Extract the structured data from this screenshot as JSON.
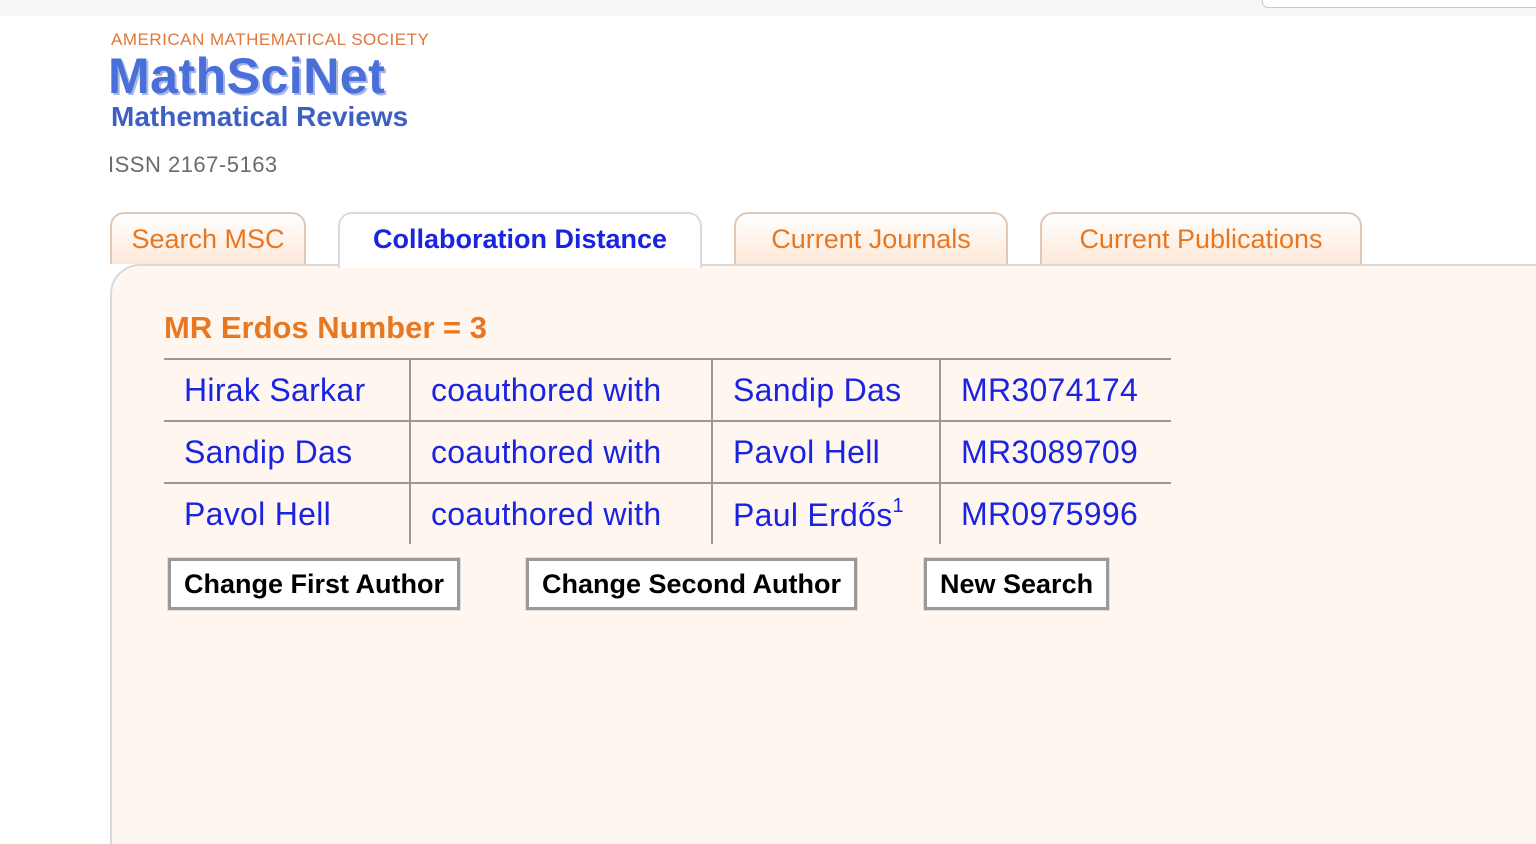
{
  "brand": {
    "society": "AMERICAN MATHEMATICAL SOCIETY",
    "product": "MathSciNet",
    "subtitle": "Mathematical Reviews",
    "issn": "ISSN 2167-5163",
    "accent_color": "#e87722",
    "brand_color": "#4a6fd8",
    "link_color": "#1a24e0"
  },
  "tabs": [
    {
      "label": "Search MSC",
      "active": false
    },
    {
      "label": "Collaboration Distance",
      "active": true
    },
    {
      "label": "Current Journals",
      "active": false
    },
    {
      "label": "Current Publications",
      "active": false
    }
  ],
  "result": {
    "title": "MR Erdos Number = 3",
    "rows": [
      {
        "author1": "Hirak Sarkar",
        "relation": "coauthored with",
        "author2": "Sandip Das",
        "author2_sup": "",
        "mr": "MR3074174"
      },
      {
        "author1": "Sandip Das",
        "relation": "coauthored with",
        "author2": "Pavol Hell",
        "author2_sup": "",
        "mr": "MR3089709"
      },
      {
        "author1": "Pavol Hell",
        "relation": "coauthored with",
        "author2": "Paul Erdős",
        "author2_sup": "1",
        "mr": "MR0975996"
      }
    ]
  },
  "buttons": {
    "change_first": "Change First Author",
    "change_second": "Change Second Author",
    "new_search": "New Search"
  }
}
